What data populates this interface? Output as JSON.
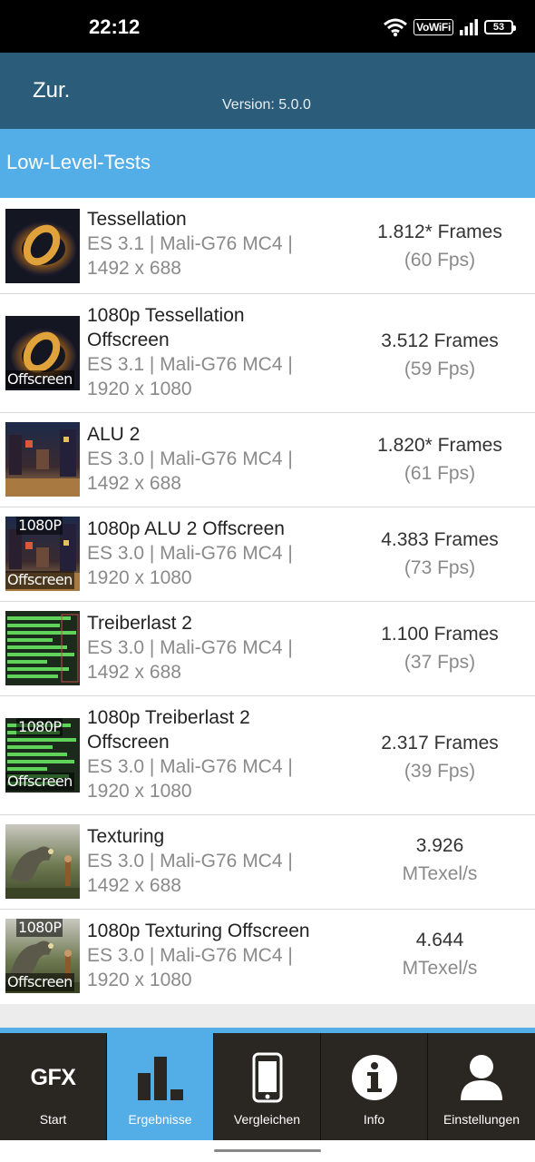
{
  "status_bar": {
    "time": "22:12",
    "vowifi": "VoWiFi",
    "battery": "53"
  },
  "header": {
    "back_label": "Zur.",
    "version": "Version: 5.0.0"
  },
  "section": {
    "title": "Low-Level-Tests"
  },
  "tests": [
    {
      "title": "Tessellation",
      "sub1": "ES 3.1 | Mali-G76 MC4 |",
      "sub2": "1492 x 688",
      "frames": "1.812* Frames",
      "fps": "(60 Fps)",
      "badge_top": "",
      "badge_bottom": "",
      "thumb_icon": "tessellation-thumbnail"
    },
    {
      "title": "1080p Tessellation",
      "title2": "Offscreen",
      "sub1": "ES 3.1 | Mali-G76 MC4 |",
      "sub2": "1920 x 1080",
      "frames": "3.512 Frames",
      "fps": "(59 Fps)",
      "badge_top": "",
      "badge_bottom": "Offscreen",
      "thumb_icon": "tessellation-thumbnail"
    },
    {
      "title": "ALU 2",
      "sub1": "ES 3.0 | Mali-G76 MC4 |",
      "sub2": "1492 x 688",
      "frames": "1.820* Frames",
      "fps": "(61 Fps)",
      "badge_top": "",
      "badge_bottom": "",
      "thumb_icon": "alu-thumbnail"
    },
    {
      "title": "1080p ALU 2 Offscreen",
      "sub1": "ES 3.0 | Mali-G76 MC4 |",
      "sub2": "1920 x 1080",
      "frames": "4.383 Frames",
      "fps": "(73 Fps)",
      "badge_top": "1080P",
      "badge_bottom": "Offscreen",
      "thumb_icon": "alu-thumbnail"
    },
    {
      "title": "Treiberlast 2",
      "sub1": "ES 3.0 | Mali-G76 MC4 |",
      "sub2": "1492 x 688",
      "frames": "1.100 Frames",
      "fps": "(37 Fps)",
      "badge_top": "",
      "badge_bottom": "",
      "thumb_icon": "driver-thumbnail"
    },
    {
      "title": "1080p Treiberlast 2",
      "title2": "Offscreen",
      "sub1": "ES 3.0 | Mali-G76 MC4 |",
      "sub2": "1920 x 1080",
      "frames": "2.317 Frames",
      "fps": "(39 Fps)",
      "badge_top": "1080P",
      "badge_bottom": "Offscreen",
      "thumb_icon": "driver-thumbnail"
    },
    {
      "title": "Texturing",
      "sub1": "ES 3.0 | Mali-G76 MC4 |",
      "sub2": "1492 x 688",
      "frames": "3.926",
      "fps": "MTexel/s",
      "badge_top": "",
      "badge_bottom": "",
      "thumb_icon": "texturing-thumbnail"
    },
    {
      "title": "1080p Texturing Offscreen",
      "sub1": "ES 3.0 | Mali-G76 MC4 |",
      "sub2": "1920 x 1080",
      "frames": "4.644",
      "fps": "MTexel/s",
      "badge_top": "1080P",
      "badge_bottom": "Offscreen",
      "thumb_icon": "texturing-thumbnail"
    }
  ],
  "nav": [
    {
      "label": "Start",
      "icon": "gfx-logo-icon",
      "icon_text": "GFX",
      "active": false
    },
    {
      "label": "Ergebnisse",
      "icon": "bar-chart-icon",
      "active": true
    },
    {
      "label": "Vergleichen",
      "icon": "smartphone-icon",
      "active": false
    },
    {
      "label": "Info",
      "icon": "info-icon",
      "active": false
    },
    {
      "label": "Einstellungen",
      "icon": "user-icon",
      "active": false
    }
  ],
  "colors": {
    "header": "#2b5d7b",
    "section": "#53ade6",
    "nav_bg": "#2a2622",
    "nav_active": "#53ade6"
  }
}
